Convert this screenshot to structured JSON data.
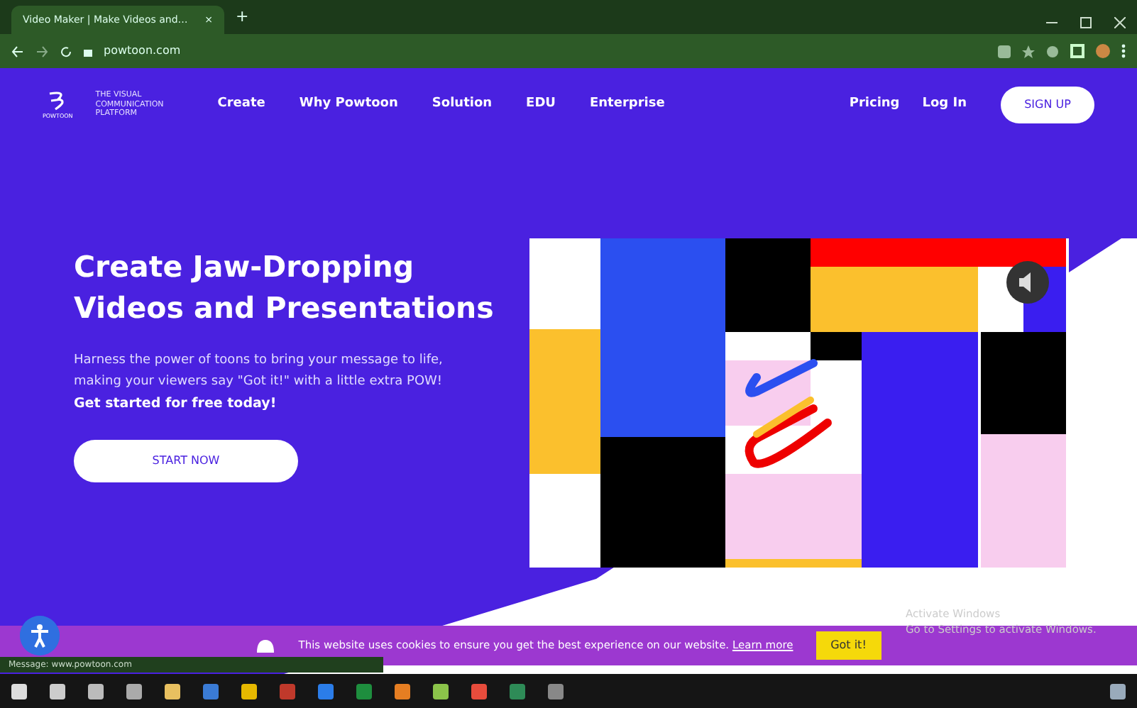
{
  "browser": {
    "tab_title": "Video Maker | Make Videos and…",
    "tab_close": "×",
    "new_tab": "+",
    "address": "powtoon.com"
  },
  "nav": {
    "logo_caption": "THE VISUAL COMMUNICATION PLATFORM",
    "logo_word": "POWTOON",
    "links": [
      "Create",
      "Why Powtoon",
      "Solution",
      "EDU",
      "Enterprise"
    ],
    "right_links": [
      "Pricing",
      "Log In"
    ],
    "signup": "SIGN UP"
  },
  "hero": {
    "title": "Create Jaw-Dropping Videos and Presentations",
    "body": "Harness the power of toons to bring your message to life, making your viewers say \"Got it!\" with a little extra POW!",
    "cta_line": "Get started for free today!",
    "button": "START NOW"
  },
  "cookie": {
    "text": "This website uses cookies to ensure you get the best experience on our website.",
    "link": "Learn more",
    "button": "Got it!"
  },
  "status_text": "Message: www.powtoon.com",
  "os_notice": [
    "Activate Windows",
    "Go to Settings to activate Windows."
  ]
}
